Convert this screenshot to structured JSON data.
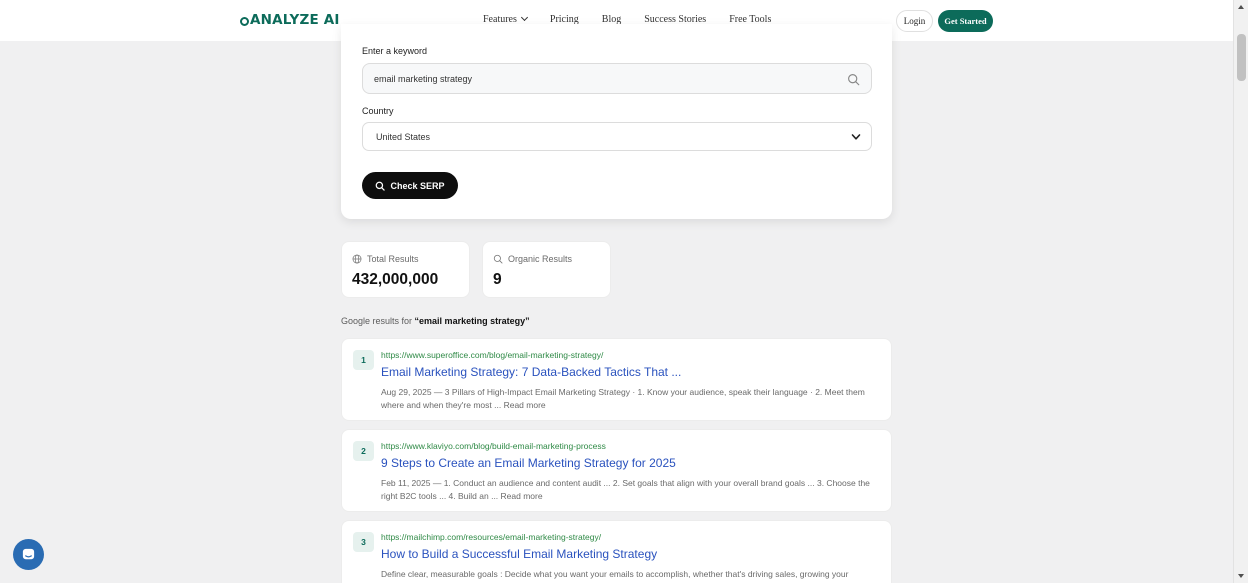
{
  "nav": {
    "logo": "ANALYZE AI",
    "links": [
      "Features",
      "Pricing",
      "Blog",
      "Success Stories",
      "Free Tools"
    ],
    "login": "Login",
    "get_started": "Get Started"
  },
  "form": {
    "keyword_label": "Enter a keyword",
    "keyword_value": "email marketing strategy",
    "country_label": "Country",
    "country_value": "United States",
    "submit_label": "Check SERP"
  },
  "stats": {
    "total_label": "Total Results",
    "total_value": "432,000,000",
    "organic_label": "Organic Results",
    "organic_value": "9"
  },
  "results_heading": {
    "prefix": "Google results for ",
    "query": "“email marketing strategy”"
  },
  "results": [
    {
      "rank": "1",
      "url": "https://www.superoffice.com/blog/email-marketing-strategy/",
      "title": "Email Marketing Strategy: 7 Data-Backed Tactics That ...",
      "snippet": "Aug 29, 2025 — 3 Pillars of High-Impact Email Marketing Strategy · 1. Know your audience, speak their language · 2. Meet them where and when they're most ... Read more"
    },
    {
      "rank": "2",
      "url": "https://www.klaviyo.com/blog/build-email-marketing-process",
      "title": "9 Steps to Create an Email Marketing Strategy for 2025",
      "snippet": "Feb 11, 2025 — 1. Conduct an audience and content audit ... 2. Set goals that align with your overall brand goals ... 3. Choose the right B2C tools ... 4. Build an ... Read more"
    },
    {
      "rank": "3",
      "url": "https://mailchimp.com/resources/email-marketing-strategy/",
      "title": "How to Build a Successful Email Marketing Strategy",
      "snippet": "Define clear, measurable goals : Decide what you want your emails to accomplish, whether that's driving sales, growing your"
    }
  ],
  "colors": {
    "brand": "#0c6b5a",
    "link": "#2a52be",
    "url": "#2f8a46",
    "chat": "#2a6cb3"
  }
}
